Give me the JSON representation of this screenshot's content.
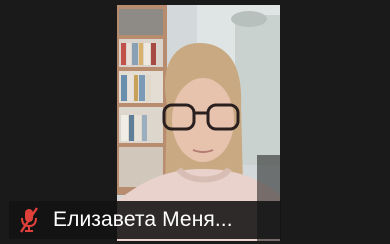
{
  "participant": {
    "name": "Елизавета Меня...",
    "muted_icon": "microphone-muted-icon",
    "mute_color": "#e0403a"
  },
  "colors": {
    "background": "#1a1a1a",
    "name_bar": "#121212"
  }
}
